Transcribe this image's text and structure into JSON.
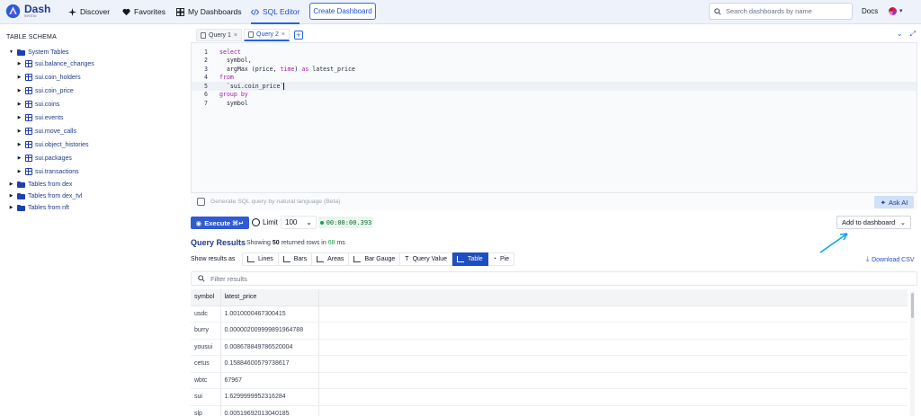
{
  "app": {
    "logo_title": "Dash",
    "logo_sub": "sentio"
  },
  "nav": {
    "discover": "Discover",
    "favorites": "Favorites",
    "my_dashboards": "My Dashboards",
    "sql_editor": "SQL Editor",
    "create_dashboard": "Create Dashboard",
    "search_placeholder": "Search dashboards by name",
    "docs": "Docs"
  },
  "sidebar": {
    "title": "TABLE SCHEMA",
    "system_tables": "System Tables",
    "tables": [
      "sui.balance_changes",
      "sui.coin_holders",
      "sui.coin_price",
      "sui.coins",
      "sui.events",
      "sui.move_calls",
      "sui.object_histories",
      "sui.packages",
      "sui.transactions"
    ],
    "groups": [
      "Tables from dex",
      "Tables from dex_tvl",
      "Tables from nft"
    ]
  },
  "tabs": [
    {
      "label": "Query 1"
    },
    {
      "label": "Query 2"
    }
  ],
  "editor": {
    "line_numbers": [
      "1",
      "2",
      "3",
      "4",
      "5",
      "6",
      "7"
    ],
    "nl_placeholder": "Generate SQL query by natural language (Beta)",
    "ask_ai": "Ask AI"
  },
  "controls": {
    "execute": "Execute ⌘↵",
    "limit_label": "Limit",
    "limit_value": "100",
    "timer": "00:00:00.393",
    "add_to_dashboard": "Add to dashboard"
  },
  "results": {
    "title": "Query Results",
    "info_prefix": "Showing",
    "row_count": "50",
    "info_mid": "returned rows in",
    "ms_value": "68",
    "ms_unit": "ms",
    "show_as": "Show results as",
    "viz_options": [
      "Lines",
      "Bars",
      "Areas",
      "Bar Gauge",
      "Query Value",
      "Table",
      "Pie"
    ],
    "active_viz": "Table",
    "download": "Download CSV",
    "filter_placeholder": "Filter results",
    "columns": [
      "symbol",
      "latest_price"
    ],
    "rows": [
      [
        "usdc",
        "1.0010000467300415"
      ],
      [
        "burry",
        "0.000002009999891964788"
      ],
      [
        "yousui",
        "0.008678849786520004"
      ],
      [
        "cetus",
        "0.15884600579738617"
      ],
      [
        "wbtc",
        "67967"
      ],
      [
        "sui",
        "1.6299999952316284"
      ],
      [
        "slp",
        "0.00519692013040185"
      ]
    ]
  },
  "colors": {
    "accent": "#2563eb",
    "topbar_bg": "#eef2fb",
    "keyword": "#a21caf",
    "success": "#16a34a"
  }
}
